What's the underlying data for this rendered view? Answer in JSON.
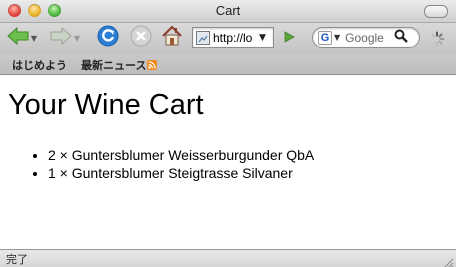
{
  "window": {
    "title": "Cart"
  },
  "navbar": {
    "back": {
      "icon": "back-arrow-icon"
    },
    "forward": {
      "icon": "forward-arrow-icon"
    },
    "reload": {
      "icon": "reload-icon"
    },
    "stop": {
      "icon": "stop-icon"
    },
    "home": {
      "icon": "home-icon"
    },
    "url": "http://lo",
    "search": {
      "engine_letter": "G",
      "placeholder": "Google"
    }
  },
  "bookmarks": {
    "items": [
      {
        "label": "はじめよう"
      },
      {
        "label": "最新ニュース",
        "icon": "rss-icon"
      }
    ]
  },
  "page": {
    "heading": "Your Wine Cart",
    "cart_items": [
      "2 × Guntersblumer Weisserburgunder QbA",
      "1 × Guntersblumer Steigtrasse Silvaner"
    ]
  },
  "status": {
    "text": "完了"
  },
  "colors": {
    "nav_green": "#5aa83c",
    "reload_blue": "#2a7fd4",
    "rss_orange": "#f08a1c"
  }
}
